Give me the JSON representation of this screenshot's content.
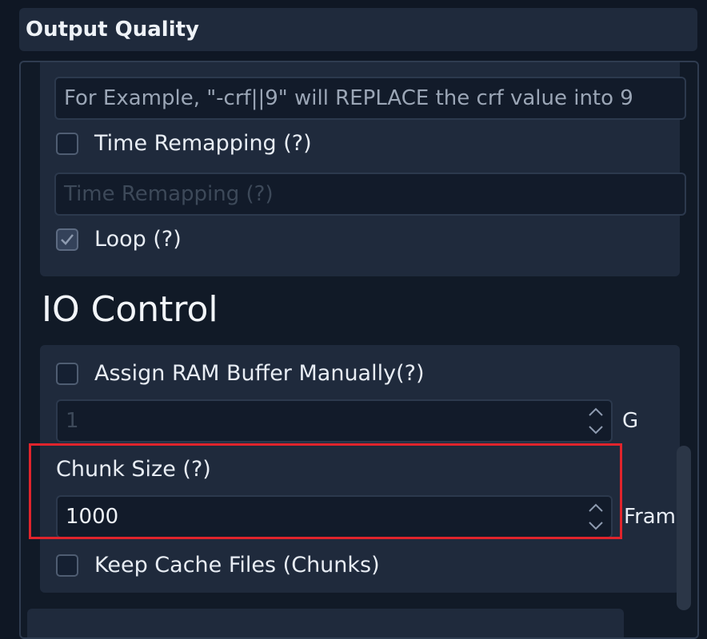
{
  "header": {
    "title": "Output Quality"
  },
  "top_card": {
    "encoder_params_placeholder": "For Example, \"-crf||9\" will REPLACE the crf value into 9",
    "time_remapping": {
      "label": "Time Remapping (?)",
      "checked": false
    },
    "time_remapping_input_placeholder": "Time Remapping (?)",
    "loop": {
      "label": "Loop (?)",
      "checked": true
    }
  },
  "io_control": {
    "title": "IO Control",
    "ram_buffer": {
      "label": "Assign RAM Buffer Manually(?)",
      "checked": false
    },
    "ram_buffer_value": "1",
    "ram_buffer_unit": "G",
    "chunk_size_label": "Chunk Size (?)",
    "chunk_size_value": "1000",
    "chunk_size_unit": "Fram",
    "keep_cache": {
      "label": "Keep Cache Files (Chunks)",
      "checked": false
    }
  },
  "colors": {
    "highlight": "#e0242c",
    "panel": "#1f2a3c",
    "background": "#0f1724"
  }
}
